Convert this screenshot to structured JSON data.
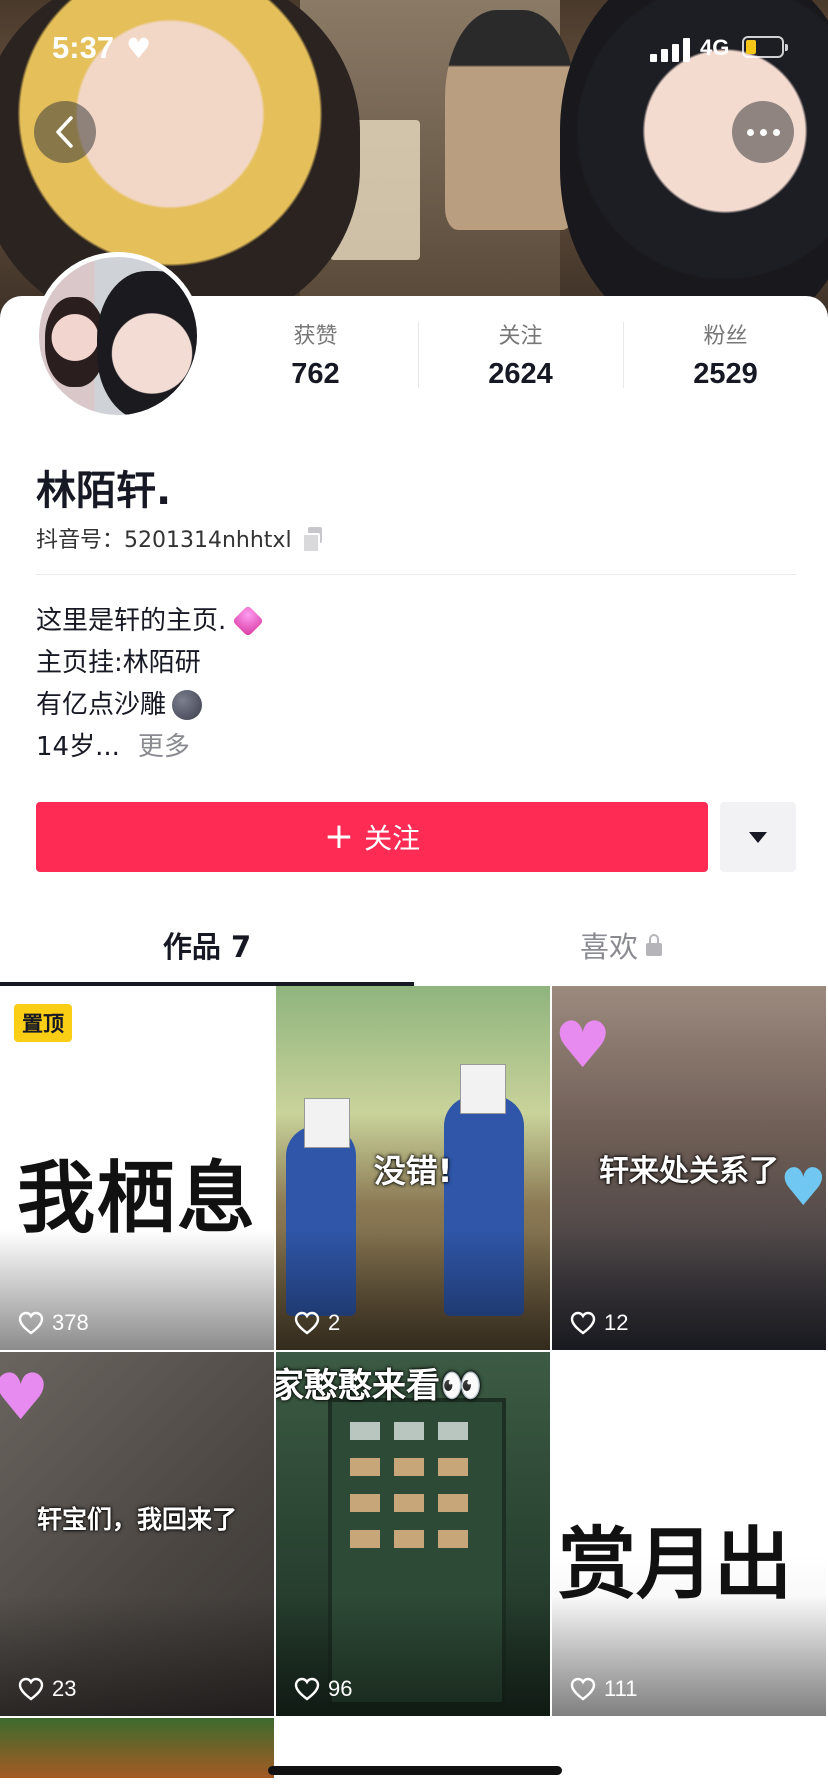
{
  "status_bar": {
    "time": "5:37",
    "network": "4G",
    "battery_level": 0.25
  },
  "header": {
    "back_icon": "chevron-left-icon",
    "more_icon": "ellipsis-icon"
  },
  "profile": {
    "name": "林陌轩.",
    "douyin_id": "抖音号：5201314nhhtxl",
    "stats": [
      {
        "label": "获赞",
        "value": "762"
      },
      {
        "label": "关注",
        "value": "2624"
      },
      {
        "label": "粉丝",
        "value": "2529"
      }
    ],
    "bio": {
      "line1": "这里是轩的主页.",
      "line2": "主页挂:林陌研",
      "line3": "有亿点沙雕",
      "line4": "14岁...",
      "more": "更多"
    }
  },
  "actions": {
    "follow_plus": "+",
    "follow_label": "关注"
  },
  "tabs": [
    {
      "label": "作品 7",
      "active": true
    },
    {
      "label": "喜欢",
      "active": false
    }
  ],
  "videos": [
    {
      "caption": "我栖息",
      "likes": "378",
      "pinned_label": "置顶"
    },
    {
      "caption": "没错!",
      "likes": "2"
    },
    {
      "caption": "轩来处关系了",
      "likes": "12"
    },
    {
      "caption": "轩宝们，我回来了",
      "likes": "23"
    },
    {
      "caption": "家憨憨来看👀",
      "likes": "96"
    },
    {
      "caption": "赏月出",
      "likes": "111"
    }
  ],
  "colors": {
    "accent": "#fe2c55",
    "pin": "#face15",
    "text": "#161823"
  }
}
